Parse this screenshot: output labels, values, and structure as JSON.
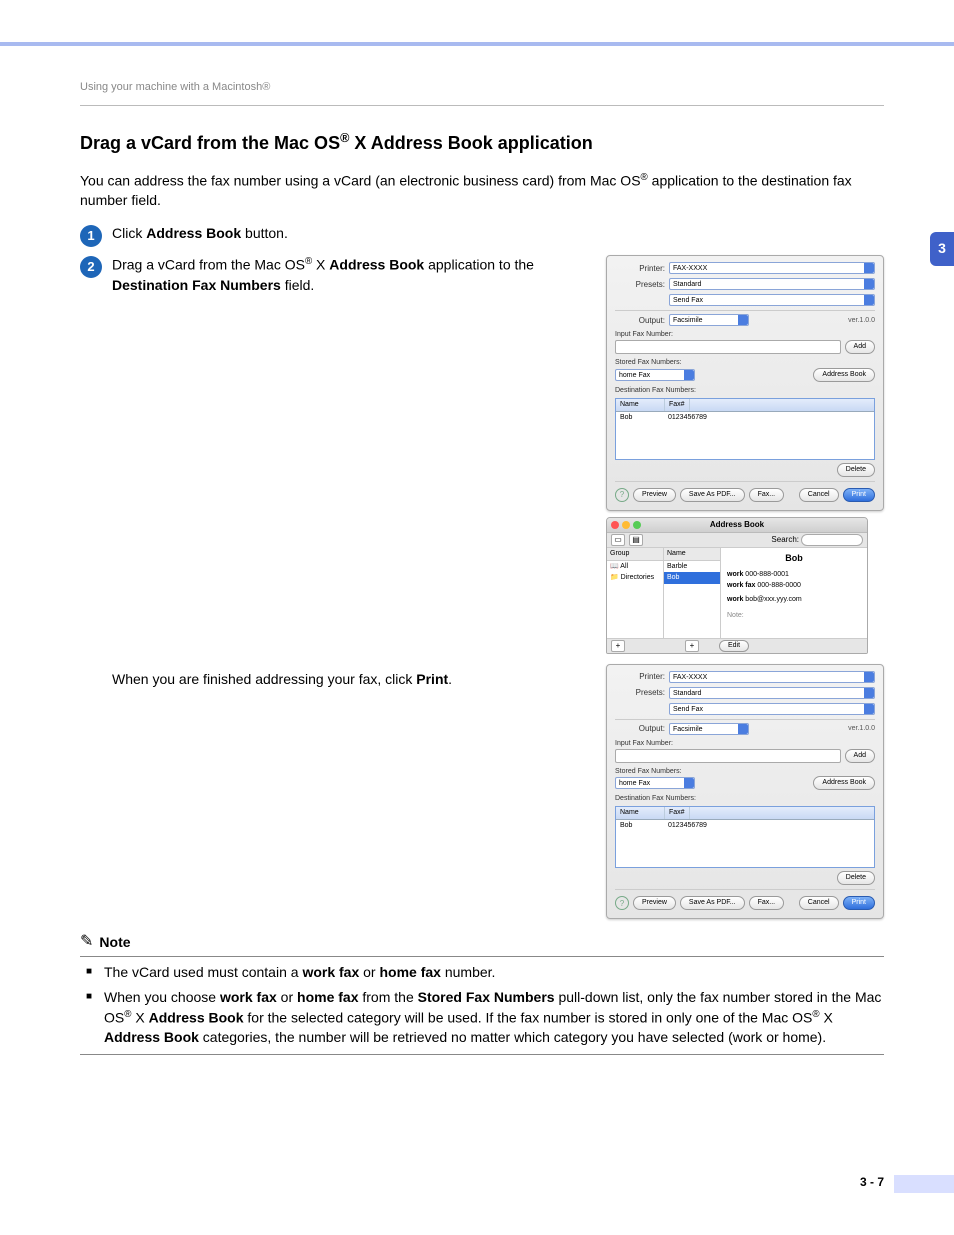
{
  "header": {
    "breadcrumb": "Using your machine with a Macintosh®"
  },
  "title": "Drag a vCard from the Mac OS® X Address Book application",
  "intro": "You can address the fax number using a vCard (an electronic business card) from Mac OS® application to the destination fax number field.",
  "steps": {
    "s1_pre": "Click ",
    "s1_bold": "Address Book",
    "s1_post": " button.",
    "s2_pre": "Drag a vCard from the Mac OS",
    "s2_mid": " X ",
    "s2_bold1": "Address Book",
    "s2_mid2": " application to the ",
    "s2_bold2": "Destination Fax Numbers",
    "s2_post": " field.",
    "finish_pre": "When you are finished addressing your fax, click ",
    "finish_bold": "Print",
    "finish_post": "."
  },
  "tab_badge": "3",
  "note": {
    "title": "Note",
    "b1_pre": "The vCard used must contain a ",
    "b1_b1": "work fax",
    "b1_mid": " or ",
    "b1_b2": "home fax",
    "b1_post": " number.",
    "b2_pre": "When you choose ",
    "b2_b1": "work fax",
    "b2_mid1": " or ",
    "b2_b2": "home fax",
    "b2_mid2": " from the ",
    "b2_b3": "Stored Fax Numbers",
    "b2_mid3": " pull-down list, only the fax number stored in the Mac OS",
    "b2_mid4": " X ",
    "b2_b4": "Address Book",
    "b2_mid5": " for the selected category will be used. If the fax number is stored in only one of the Mac OS",
    "b2_mid6": " X ",
    "b2_b5": "Address Book",
    "b2_post": " categories, the number will be retrieved no matter which category you have selected (work or home)."
  },
  "page_number": "3 - 7",
  "dialog": {
    "lbl_printer": "Printer:",
    "val_printer": "FAX-XXXX",
    "lbl_presets": "Presets:",
    "val_presets": "Standard",
    "val_pane": "Send Fax",
    "lbl_output": "Output:",
    "val_output": "Facsimile",
    "version": "ver.1.0.0",
    "lbl_input": "Input Fax Number:",
    "btn_add": "Add",
    "lbl_stored": "Stored Fax Numbers:",
    "val_stored": "home Fax",
    "btn_abook": "Address Book",
    "lbl_dest": "Destination Fax Numbers:",
    "th_name": "Name",
    "th_fax": "Fax#",
    "row_name": "Bob",
    "row_fax": "0123456789",
    "btn_delete": "Delete",
    "btn_preview": "Preview",
    "btn_savepdf": "Save As PDF...",
    "btn_fax": "Fax...",
    "btn_cancel": "Cancel",
    "btn_print": "Print",
    "help": "?"
  },
  "abook": {
    "title": "Address Book",
    "search_lbl": "Search:",
    "col_group": "Group",
    "col_name": "Name",
    "grp_all": "All",
    "grp_dir": "Directories",
    "nm_barble": "Barble",
    "nm_bob": "Bob",
    "card_name": "Bob",
    "line1_lbl": "work",
    "line1_val": "000-888-0001",
    "line2_lbl": "work fax",
    "line2_val": "000-888-0000",
    "line3_lbl": "work",
    "line3_val": "bob@xxx.yyy.com",
    "note_lbl": "Note:",
    "btn_edit": "Edit",
    "plus": "+"
  }
}
